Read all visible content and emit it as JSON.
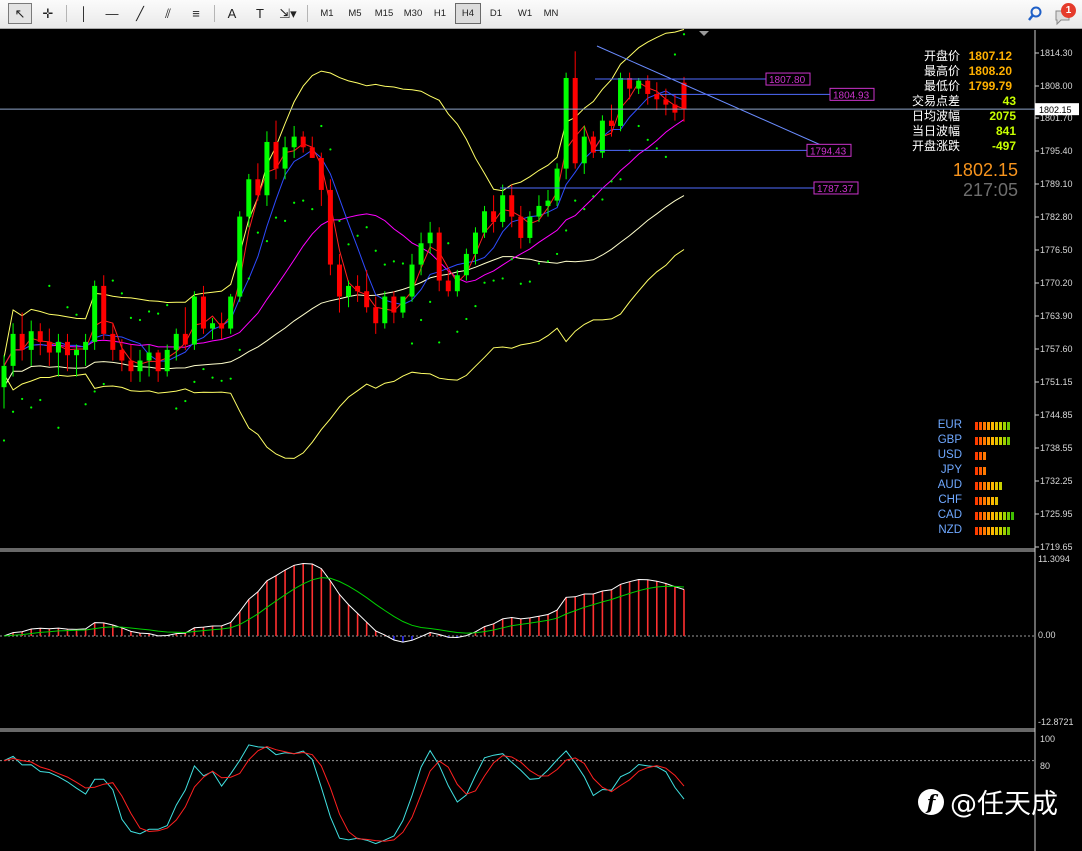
{
  "toolbar": {
    "tools": [
      {
        "name": "cursor-tool",
        "icon": "arrow-cursor-icon",
        "glyph": "↖",
        "active": true
      },
      {
        "name": "crosshair-tool",
        "icon": "crosshair-icon",
        "glyph": "✛",
        "active": false
      },
      {
        "name": "vertical-line-tool",
        "icon": "vertical-line-icon",
        "glyph": "│",
        "active": false
      },
      {
        "name": "horizontal-line-tool",
        "icon": "horizontal-line-icon",
        "glyph": "—",
        "active": false
      },
      {
        "name": "trendline-tool",
        "icon": "trendline-icon",
        "glyph": "╱",
        "active": false
      },
      {
        "name": "channel-tool",
        "icon": "equidistant-channel-icon",
        "glyph": "⫽",
        "active": false
      },
      {
        "name": "fibonacci-tool",
        "icon": "fibonacci-icon",
        "glyph": "≡",
        "active": false
      },
      {
        "name": "text-tool",
        "icon": "text-icon",
        "glyph": "A",
        "active": false
      },
      {
        "name": "text-label-tool",
        "icon": "text-label-icon",
        "glyph": "T",
        "active": false
      },
      {
        "name": "arrows-tool",
        "icon": "arrows-dropdown-icon",
        "glyph": "⇲▾",
        "active": false
      }
    ],
    "timeframes": [
      "M1",
      "M5",
      "M15",
      "M30",
      "H1",
      "H4",
      "D1",
      "W1",
      "MN"
    ],
    "active_timeframe": "H4",
    "notification_count": "1"
  },
  "info_panel": [
    {
      "label": "开盘价",
      "value": "1807.12",
      "color": "orange"
    },
    {
      "label": "最高价",
      "value": "1808.20",
      "color": "orange"
    },
    {
      "label": "最低价",
      "value": "1799.79",
      "color": "orange"
    },
    {
      "label": "交易点差",
      "value": "43",
      "color": "green"
    },
    {
      "label": "日均波幅",
      "value": "2075",
      "color": "green"
    },
    {
      "label": "当日波幅",
      "value": "841",
      "color": "green"
    },
    {
      "label": "开盘涨跌",
      "value": "-497",
      "color": "green"
    }
  ],
  "current_price": "1802.15",
  "bar_timer": "217:05",
  "price_axis": [
    "1814.30",
    "1808.00",
    "1801.70",
    "1795.40",
    "1789.10",
    "1782.80",
    "1776.50",
    "1770.20",
    "1763.90",
    "1757.60",
    "1751.15",
    "1744.85",
    "1738.55",
    "1732.25",
    "1725.95",
    "1719.65"
  ],
  "current_price_tag": "1802.15",
  "price_labels": [
    {
      "text": "1807.80",
      "value": 1807.8
    },
    {
      "text": "1804.93",
      "value": 1804.93
    },
    {
      "text": "1794.43",
      "value": 1794.43
    },
    {
      "text": "1787.37",
      "value": 1787.37
    }
  ],
  "currency_strength": [
    {
      "name": "EUR",
      "bars": 9
    },
    {
      "name": "GBP",
      "bars": 9
    },
    {
      "name": "USD",
      "bars": 3
    },
    {
      "name": "JPY",
      "bars": 3
    },
    {
      "name": "AUD",
      "bars": 7
    },
    {
      "name": "CHF",
      "bars": 6
    },
    {
      "name": "CAD",
      "bars": 10
    },
    {
      "name": "NZD",
      "bars": 9
    }
  ],
  "macd_axis": {
    "top": "11.3094",
    "zero": "0.00",
    "bottom": "-12.8721"
  },
  "stoch_axis": {
    "top": "100",
    "level": "80"
  },
  "watermark": "@任天成",
  "colors": {
    "bull": "#00ff00",
    "bear": "#ff0000",
    "band": "#ffff66",
    "ma_magenta": "#ff00ff",
    "ma_blue": "#2e4bff",
    "trend": "#6a8cff",
    "label": "#cc33cc"
  },
  "chart_data": {
    "type": "candlestick",
    "symbol_timeframe": "H4",
    "y_range": [
      1719.65,
      1817.0
    ],
    "candles": [
      [
        1750.0,
        1756.0,
        1746.0,
        1754.0
      ],
      [
        1754.0,
        1762.0,
        1752.0,
        1760.0
      ],
      [
        1760.0,
        1764.0,
        1755.0,
        1757.0
      ],
      [
        1757.0,
        1762.5,
        1754.0,
        1760.5
      ],
      [
        1760.5,
        1762.0,
        1756.0,
        1758.5
      ],
      [
        1758.5,
        1761.0,
        1754.0,
        1756.5
      ],
      [
        1756.5,
        1760.0,
        1752.0,
        1758.5
      ],
      [
        1758.5,
        1760.0,
        1753.0,
        1756.0
      ],
      [
        1756.0,
        1758.0,
        1752.0,
        1757.0
      ],
      [
        1757.0,
        1760.0,
        1754.0,
        1758.5
      ],
      [
        1758.5,
        1770.0,
        1757.0,
        1769.0
      ],
      [
        1769.0,
        1771.0,
        1759.0,
        1760.0
      ],
      [
        1760.0,
        1762.0,
        1755.0,
        1757.0
      ],
      [
        1757.0,
        1759.0,
        1753.0,
        1755.0
      ],
      [
        1755.0,
        1758.0,
        1751.0,
        1753.0
      ],
      [
        1753.0,
        1757.0,
        1751.0,
        1755.0
      ],
      [
        1755.0,
        1758.0,
        1752.0,
        1756.5
      ],
      [
        1756.5,
        1757.0,
        1751.0,
        1753.0
      ],
      [
        1753.0,
        1758.0,
        1752.0,
        1757.0
      ],
      [
        1757.0,
        1761.0,
        1755.0,
        1760.0
      ],
      [
        1760.0,
        1765.0,
        1757.0,
        1758.0
      ],
      [
        1758.0,
        1768.0,
        1757.0,
        1767.0
      ],
      [
        1767.0,
        1769.0,
        1760.0,
        1761.0
      ],
      [
        1761.0,
        1763.0,
        1759.0,
        1762.0
      ],
      [
        1762.0,
        1764.0,
        1759.0,
        1761.0
      ],
      [
        1761.0,
        1767.5,
        1760.0,
        1767.0
      ],
      [
        1767.0,
        1783.0,
        1766.0,
        1782.0
      ],
      [
        1782.0,
        1790.0,
        1780.0,
        1789.0
      ],
      [
        1789.0,
        1792.0,
        1785.0,
        1786.0
      ],
      [
        1786.0,
        1798.0,
        1784.0,
        1796.0
      ],
      [
        1796.0,
        1800.0,
        1789.0,
        1791.0
      ],
      [
        1791.0,
        1797.0,
        1789.0,
        1795.0
      ],
      [
        1795.0,
        1799.0,
        1793.0,
        1797.0
      ],
      [
        1797.0,
        1798.0,
        1794.0,
        1795.0
      ],
      [
        1795.0,
        1797.0,
        1793.0,
        1793.0
      ],
      [
        1793.0,
        1794.0,
        1784.0,
        1787.0
      ],
      [
        1787.0,
        1789.0,
        1771.0,
        1773.0
      ],
      [
        1773.0,
        1775.0,
        1764.0,
        1767.0
      ],
      [
        1767.0,
        1770.0,
        1765.0,
        1769.0
      ],
      [
        1769.0,
        1771.0,
        1766.0,
        1768.0
      ],
      [
        1768.0,
        1772.0,
        1764.0,
        1765.0
      ],
      [
        1765.0,
        1767.0,
        1760.0,
        1762.0
      ],
      [
        1762.0,
        1768.0,
        1761.0,
        1767.0
      ],
      [
        1767.0,
        1768.0,
        1762.0,
        1764.0
      ],
      [
        1764.0,
        1767.0,
        1763.0,
        1767.0
      ],
      [
        1767.0,
        1775.0,
        1766.0,
        1773.0
      ],
      [
        1773.0,
        1779.0,
        1771.0,
        1777.0
      ],
      [
        1777.0,
        1781.0,
        1775.0,
        1779.0
      ],
      [
        1779.0,
        1780.0,
        1768.0,
        1770.0
      ],
      [
        1770.0,
        1772.0,
        1767.0,
        1768.0
      ],
      [
        1768.0,
        1772.0,
        1767.0,
        1771.0
      ],
      [
        1771.0,
        1776.0,
        1770.0,
        1775.0
      ],
      [
        1775.0,
        1780.0,
        1773.0,
        1779.0
      ],
      [
        1779.0,
        1784.0,
        1778.0,
        1783.0
      ],
      [
        1783.0,
        1786.0,
        1779.0,
        1781.0
      ],
      [
        1781.0,
        1788.0,
        1780.0,
        1786.0
      ],
      [
        1786.0,
        1788.0,
        1780.0,
        1782.0
      ],
      [
        1782.0,
        1784.0,
        1776.0,
        1778.0
      ],
      [
        1778.0,
        1783.0,
        1777.0,
        1782.0
      ],
      [
        1782.0,
        1786.0,
        1781.0,
        1784.0
      ],
      [
        1784.0,
        1787.0,
        1782.0,
        1785.0
      ],
      [
        1785.0,
        1792.0,
        1784.0,
        1791.0
      ],
      [
        1791.0,
        1809.0,
        1789.0,
        1808.0
      ],
      [
        1808.0,
        1813.0,
        1791.0,
        1792.0
      ],
      [
        1792.0,
        1799.0,
        1790.0,
        1797.0
      ],
      [
        1797.0,
        1798.0,
        1793.0,
        1794.0
      ],
      [
        1794.0,
        1801.0,
        1793.0,
        1800.0
      ],
      [
        1800.0,
        1803.0,
        1797.0,
        1799.0
      ],
      [
        1799.0,
        1809.0,
        1798.0,
        1808.0
      ],
      [
        1808.0,
        1809.0,
        1804.0,
        1806.0
      ],
      [
        1806.0,
        1808.0,
        1805.0,
        1807.5
      ],
      [
        1807.5,
        1808.5,
        1803.0,
        1805.0
      ],
      [
        1805.0,
        1807.2,
        1802.0,
        1804.0
      ],
      [
        1804.0,
        1806.0,
        1801.0,
        1803.0
      ],
      [
        1803.0,
        1805.0,
        1800.0,
        1801.5
      ],
      [
        1807.12,
        1808.2,
        1799.79,
        1802.15
      ]
    ],
    "macd_range": [
      -12.8721,
      11.3094
    ],
    "stoch_range": [
      0,
      100
    ]
  }
}
